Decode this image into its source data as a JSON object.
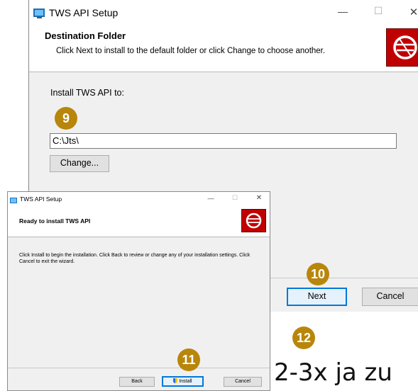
{
  "back_window": {
    "title": "TWS API Setup",
    "header_title": "Destination Folder",
    "header_subtitle": "Click Next to install to the default folder or click Change to choose another.",
    "install_label": "Install TWS API to:",
    "path_value": "C:\\Jts\\",
    "change_button": "Change...",
    "next_button": "Next",
    "cancel_button": "Cancel"
  },
  "front_window": {
    "title": "TWS API Setup",
    "header_title": "Ready to install TWS API",
    "body_text": "Click Install to begin the installation. Click Back to review or change any of your installation settings. Click Cancel to exit the wizard.",
    "back_button": "Back",
    "install_button": "Install",
    "cancel_button": "Cancel"
  },
  "window_controls": {
    "minimize": "—",
    "maximize": "☐",
    "close": "✕"
  },
  "badges": {
    "b9": "9",
    "b10": "10",
    "b11": "11",
    "b12": "12"
  },
  "annotation_text": "2-3x ja zu",
  "colors": {
    "badge": "#b8860b",
    "logo_red": "#c00000",
    "primary_border": "#0078d7"
  }
}
